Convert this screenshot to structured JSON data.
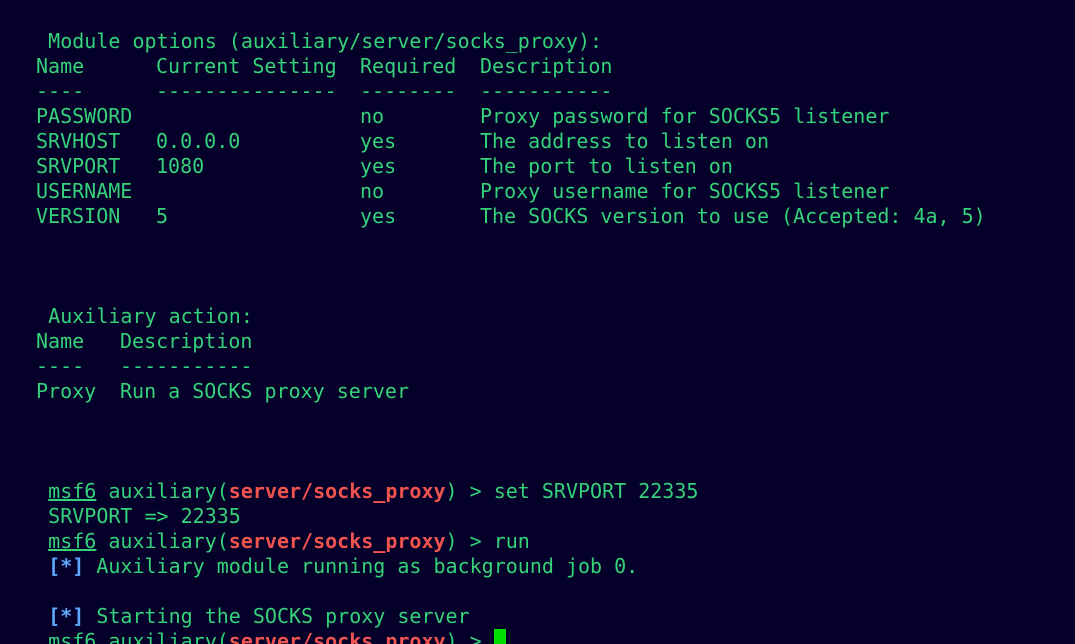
{
  "module_header": "Module options (auxiliary/server/socks_proxy):",
  "options_table": {
    "headers": [
      "Name",
      "Current Setting",
      "Required",
      "Description"
    ],
    "separators": [
      "----",
      "---------------",
      "--------",
      "-----------"
    ],
    "rows": [
      {
        "name": "PASSWORD",
        "setting": "",
        "required": "no",
        "description": "Proxy password for SOCKS5 listener"
      },
      {
        "name": "SRVHOST",
        "setting": "0.0.0.0",
        "required": "yes",
        "description": "The address to listen on"
      },
      {
        "name": "SRVPORT",
        "setting": "1080",
        "required": "yes",
        "description": "The port to listen on"
      },
      {
        "name": "USERNAME",
        "setting": "",
        "required": "no",
        "description": "Proxy username for SOCKS5 listener"
      },
      {
        "name": "VERSION",
        "setting": "5",
        "required": "yes",
        "description": "The SOCKS version to use (Accepted: 4a, 5)"
      }
    ]
  },
  "action_header": "Auxiliary action:",
  "action_table": {
    "headers": [
      "Name",
      "Description"
    ],
    "separators": [
      "----",
      "-----------"
    ],
    "rows": [
      {
        "name": "Proxy",
        "description": "Run a SOCKS proxy server"
      }
    ]
  },
  "prompt": {
    "msf": "msf6",
    "middle": " auxiliary(",
    "module": "server/socks_proxy",
    "end": ") > "
  },
  "commands": [
    "set SRVPORT 22335",
    "run",
    ""
  ],
  "output": {
    "set_result": "SRVPORT => 22335",
    "star": "[*]",
    "bg_job": " Auxiliary module running as background job 0.",
    "starting": " Starting the SOCKS proxy server"
  },
  "colors": {
    "background": "#04002a",
    "text": "#36d27a",
    "module_red": "#f0544f",
    "status_blue": "#5fa8ff",
    "cursor": "#00e000"
  }
}
